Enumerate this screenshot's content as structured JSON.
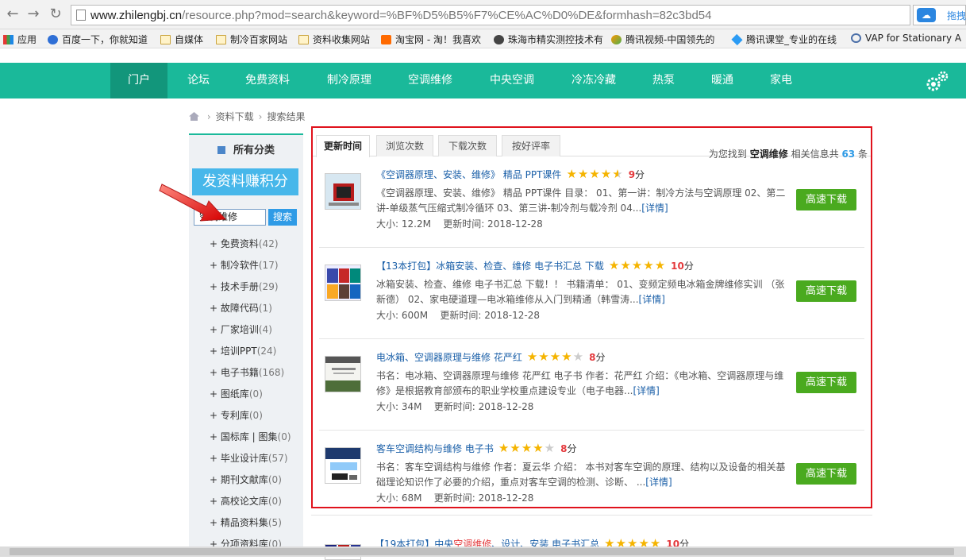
{
  "browser": {
    "url_host": "www.zhilengbj.cn",
    "url_path": "/resource.php?mod=search&keyword=%BF%D5%B5%F7%CE%AC%D0%DE&formhash=82c3bd54",
    "ext_label": "拖拽"
  },
  "bookmarks": [
    {
      "label": "应用"
    },
    {
      "label": "百度一下，你就知道"
    },
    {
      "label": "自媒体"
    },
    {
      "label": "制冷百家网站"
    },
    {
      "label": "资料收集网站"
    },
    {
      "label": "淘宝网 - 淘！我喜欢"
    },
    {
      "label": "珠海市精实测控技术有"
    },
    {
      "label": "腾讯视频-中国领先的"
    },
    {
      "label": "腾讯课堂_专业的在线"
    },
    {
      "label": "VAP for Stationary A"
    }
  ],
  "topnav": [
    "门户",
    "论坛",
    "免费资料",
    "制冷原理",
    "空调维修",
    "中央空调",
    "冷冻冷藏",
    "热泵",
    "暖通",
    "家电"
  ],
  "breadcrumb": [
    "资料下载",
    "搜索结果"
  ],
  "sidebar": {
    "title": "所有分类",
    "post_button": "发资料赚积分",
    "search_value": "空调维修",
    "search_button": "搜索",
    "categories": [
      {
        "name": "+ 免费资料",
        "count": "(42)"
      },
      {
        "name": "+ 制冷软件",
        "count": "(17)"
      },
      {
        "name": "+ 技术手册",
        "count": "(29)"
      },
      {
        "name": "+ 故障代码",
        "count": "(1)"
      },
      {
        "name": "+ 厂家培训",
        "count": "(4)"
      },
      {
        "name": "+ 培训PPT",
        "count": "(24)"
      },
      {
        "name": "+ 电子书籍",
        "count": "(168)"
      },
      {
        "name": "+ 图纸库",
        "count": "(0)"
      },
      {
        "name": "+ 专利库",
        "count": "(0)"
      },
      {
        "name": "+ 国标库 | 图集",
        "count": "(0)"
      },
      {
        "name": "+ 毕业设计库",
        "count": "(57)"
      },
      {
        "name": "+ 期刊文献库",
        "count": "(0)"
      },
      {
        "name": "+ 高校论文库",
        "count": "(0)"
      },
      {
        "name": "+ 精品资料集",
        "count": "(5)"
      },
      {
        "name": "+ 分项资料库",
        "count": "(0)"
      }
    ]
  },
  "tabs": [
    "更新时间",
    "浏览次数",
    "下载次数",
    "按好评率"
  ],
  "found": {
    "prefix": "为您找到",
    "keyword": "空调维修",
    "middle": "相关信息共",
    "count": "63",
    "suffix": "条"
  },
  "results": [
    {
      "title": "《空调器原理、安装、维修》 精品 PPT课件",
      "stars": 4.5,
      "score": "9",
      "unit": "分",
      "desc": "《空调器原理、安装、维修》 精品 PPT课件 目录： 01、第一讲：制冷方法与空调原理 02、第二讲-单级蒸气压缩式制冷循环 03、第三讲-制冷剂与载冷剂 04...",
      "detail": "[详情]",
      "size": "大小: 12.2M",
      "updated": "更新时间: 2018-12-28",
      "download": "高速下载"
    },
    {
      "title": "【13本打包】冰箱安装、检查、维修 电子书汇总 下载",
      "stars": 5,
      "score": "10",
      "unit": "分",
      "desc": "冰箱安装、检查、维修 电子书汇总 下载！！ 书籍清单： 01、变频定频电冰箱金牌维修实训 （张新德） 02、家电硬道理—电冰箱维修从入门到精通（韩雪涛...",
      "detail": "[详情]",
      "size": "大小: 600M",
      "updated": "更新时间: 2018-12-28",
      "download": "高速下载"
    },
    {
      "title": "电冰箱、空调器原理与维修 花严红",
      "stars": 4,
      "score": "8",
      "unit": "分",
      "desc": "书名：电冰箱、空调器原理与维修 花严红 电子书 作者：花严红 介绍：《电冰箱、空调器原理与维修》是根据教育部颁布的职业学校重点建设专业（电子电器...",
      "detail": "[详情]",
      "size": "大小: 34M",
      "updated": "更新时间: 2018-12-28",
      "download": "高速下载"
    },
    {
      "title": "客车空调结构与维修 电子书",
      "stars": 4,
      "score": "8",
      "unit": "分",
      "desc": "书名：客车空调结构与维修 作者：夏云华 介绍： 本书对客车空调的原理、结构以及设备的相关基础理论知识作了必要的介绍，重点对客车空调的检测、诊断、 ...",
      "detail": "[详情]",
      "size": "大小: 68M",
      "updated": "更新时间: 2018-12-28",
      "download": "高速下载"
    }
  ],
  "partial_result": {
    "title_pre": "【19本打包】中央",
    "title_kw": "空调维修",
    "title_post": "、设计、安装 电子书汇总",
    "stars": 5,
    "score": "10",
    "unit": "分"
  },
  "colors": {
    "brand": "#1ab99a",
    "highlight_border": "#e0121c",
    "download": "#4aaa1f",
    "link": "#1a5fa8"
  }
}
